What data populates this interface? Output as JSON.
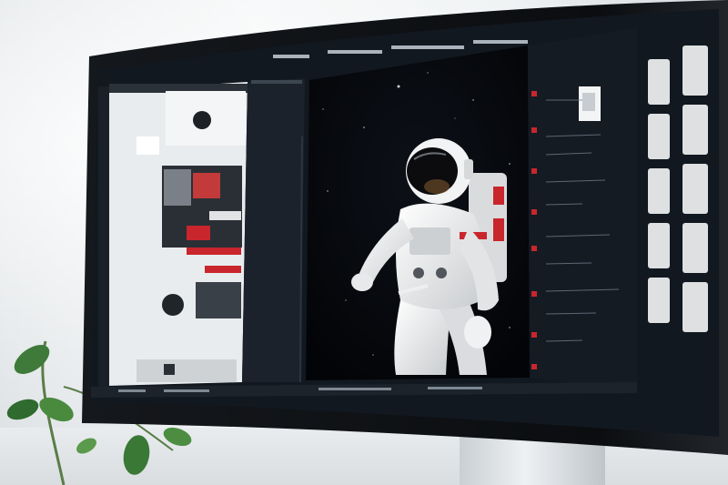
{
  "scene": {
    "description_label": "",
    "palette": {
      "wall": "#eef1f3",
      "bezel": "#0b0d10",
      "screen_bg": "#0f141a",
      "space": "#05070b",
      "suit": "#e9eaeb",
      "accent_red": "#c8262c",
      "leaf": "#3f7a3a"
    },
    "icons": [
      "plant-icon",
      "astronaut-icon",
      "helmet-icon"
    ]
  }
}
